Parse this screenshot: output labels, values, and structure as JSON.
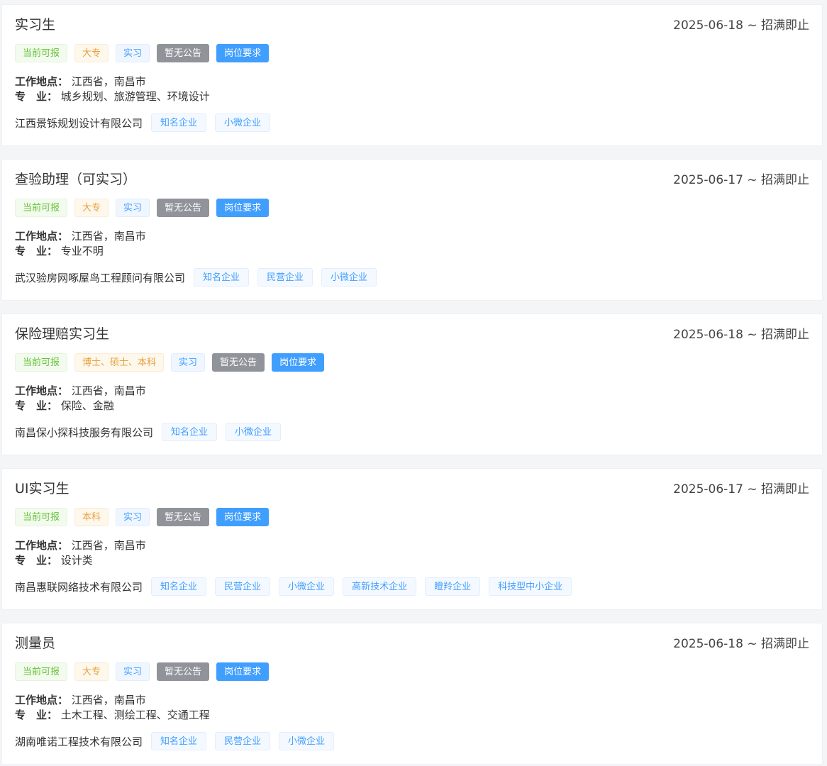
{
  "jobs": [
    {
      "title": "实习生",
      "date": "2025-06-18 ~ 招满即止",
      "tags": [
        "当前可报",
        "大专",
        "实习",
        "暂无公告",
        "岗位要求"
      ],
      "location_label": "工作地点：",
      "location": "江西省，南昌市",
      "major_label": "专　业：",
      "major": "城乡规划、旅游管理、环境设计",
      "company": "江西景铄规划设计有限公司",
      "company_tags": [
        "知名企业",
        "小微企业"
      ]
    },
    {
      "title": "查验助理（可实习）",
      "date": "2025-06-17 ~ 招满即止",
      "tags": [
        "当前可报",
        "大专",
        "实习",
        "暂无公告",
        "岗位要求"
      ],
      "location_label": "工作地点：",
      "location": "江西省，南昌市",
      "major_label": "专　业：",
      "major": "专业不明",
      "company": "武汉验房网啄屋鸟工程顾问有限公司",
      "company_tags": [
        "知名企业",
        "民营企业",
        "小微企业"
      ]
    },
    {
      "title": "保险理赔实习生",
      "date": "2025-06-18 ~ 招满即止",
      "tags": [
        "当前可报",
        "博士、硕士、本科",
        "实习",
        "暂无公告",
        "岗位要求"
      ],
      "location_label": "工作地点：",
      "location": "江西省，南昌市",
      "major_label": "专　业：",
      "major": "保险、金融",
      "company": "南昌保小探科技服务有限公司",
      "company_tags": [
        "知名企业",
        "小微企业"
      ]
    },
    {
      "title": "UI实习生",
      "date": "2025-06-17 ~ 招满即止",
      "tags": [
        "当前可报",
        "本科",
        "实习",
        "暂无公告",
        "岗位要求"
      ],
      "location_label": "工作地点：",
      "location": "江西省，南昌市",
      "major_label": "专　业：",
      "major": "设计类",
      "company": "南昌惠联网络技术有限公司",
      "company_tags": [
        "知名企业",
        "民营企业",
        "小微企业",
        "高新技术企业",
        "瞪羚企业",
        "科技型中小企业"
      ]
    },
    {
      "title": "测量员",
      "date": "2025-06-18 ~ 招满即止",
      "tags": [
        "当前可报",
        "大专",
        "实习",
        "暂无公告",
        "岗位要求"
      ],
      "location_label": "工作地点：",
      "location": "江西省，南昌市",
      "major_label": "专　业：",
      "major": "土木工程、测绘工程、交通工程",
      "company": "湖南唯诺工程技术有限公司",
      "company_tags": [
        "知名企业",
        "民营企业",
        "小微企业"
      ]
    }
  ]
}
